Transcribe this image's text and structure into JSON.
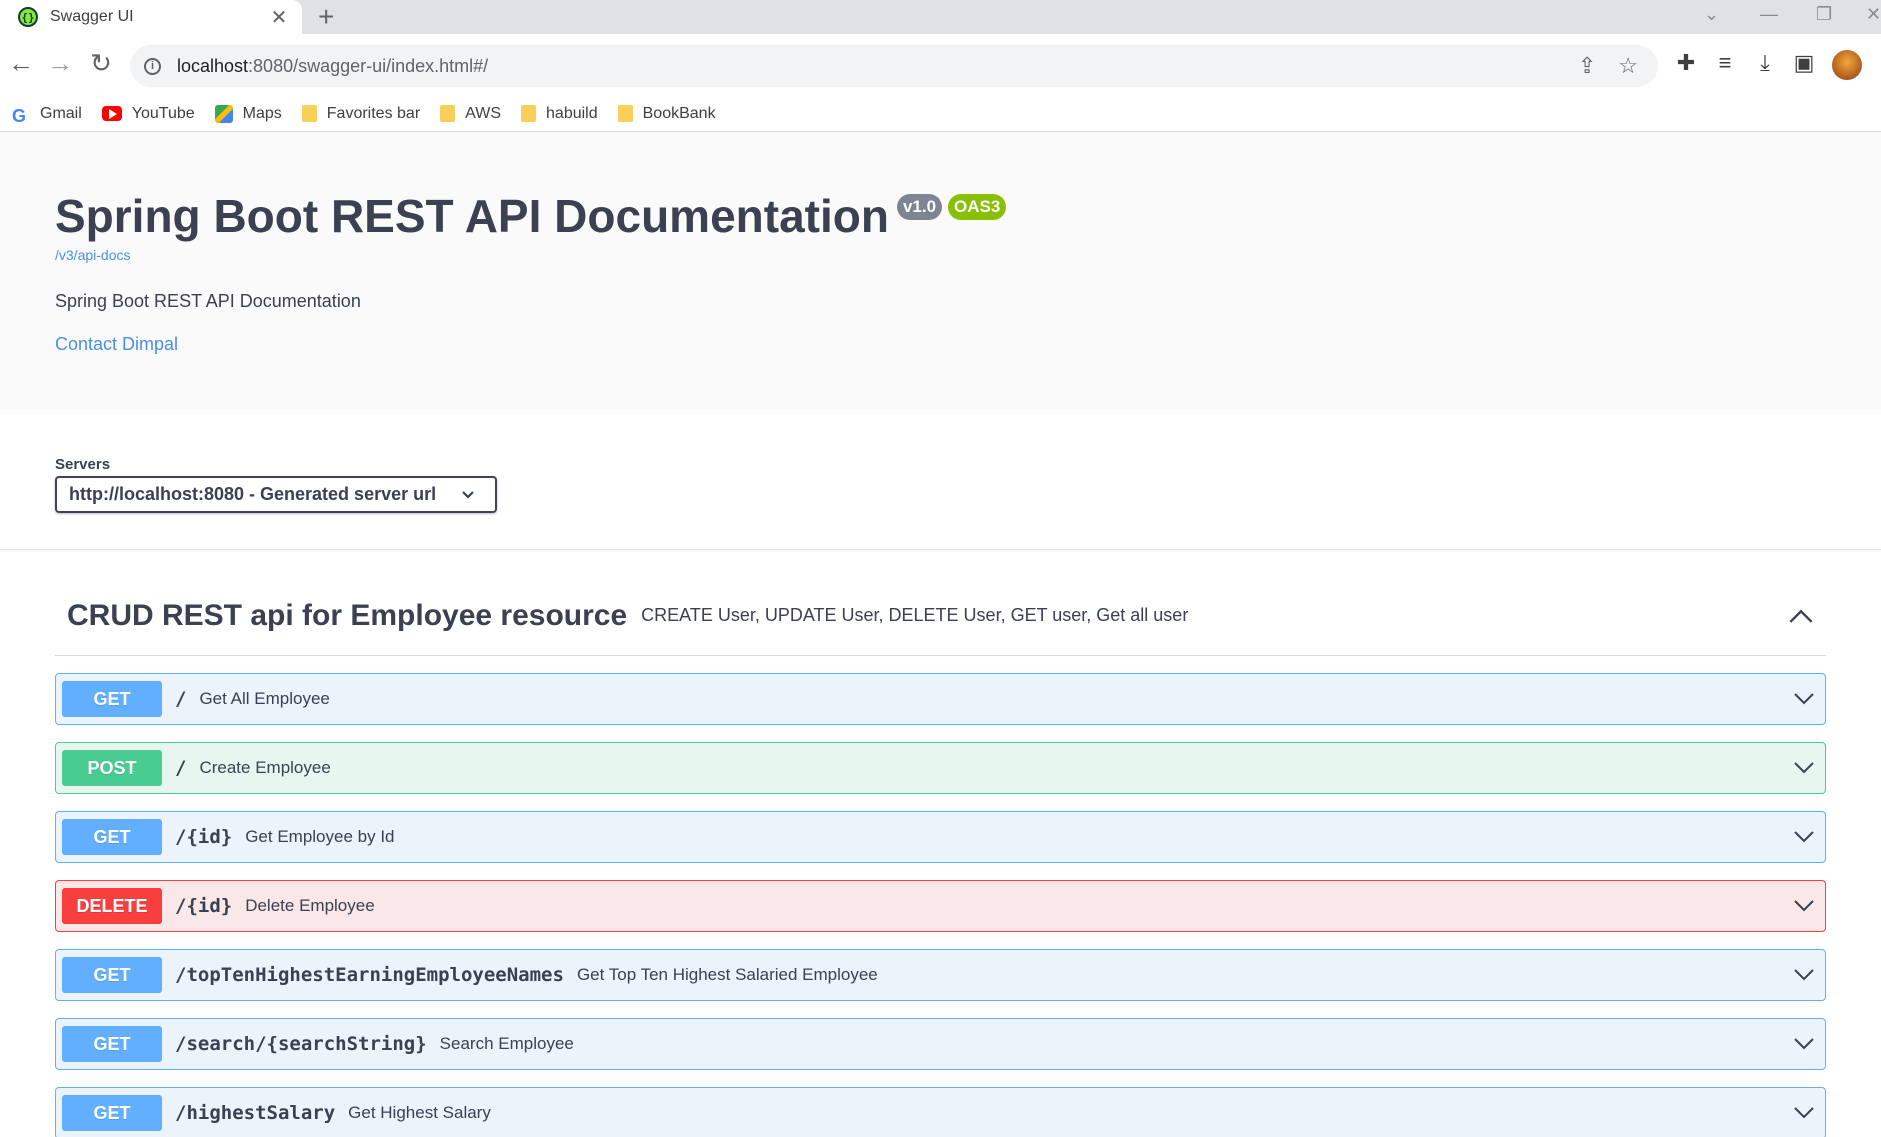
{
  "browser": {
    "tab_title": "Swagger UI",
    "tab_close": "✕",
    "new_tab": "+",
    "url_host": "localhost",
    "url_rest": ":8080/swagger-ui/index.html#/",
    "bookmarks": [
      "Gmail",
      "YouTube",
      "Maps",
      "Favorites bar",
      "AWS",
      "habuild",
      "BookBank"
    ]
  },
  "info": {
    "title": "Spring Boot REST API Documentation",
    "version": "v1.0",
    "oas": "OAS3",
    "api_docs_link": "/v3/api-docs",
    "description": "Spring Boot REST API Documentation",
    "contact": "Contact Dimpal"
  },
  "servers": {
    "label": "Servers",
    "selected": "http://localhost:8080 - Generated server url"
  },
  "tag": {
    "name": "CRUD REST api for Employee resource",
    "description": "CREATE User, UPDATE User, DELETE User, GET user, Get all user"
  },
  "operations": [
    {
      "method": "GET",
      "path": "/",
      "summary": "Get All Employee"
    },
    {
      "method": "POST",
      "path": "/",
      "summary": "Create Employee"
    },
    {
      "method": "GET",
      "path": "/{id}",
      "summary": "Get Employee by Id"
    },
    {
      "method": "DELETE",
      "path": "/{id}",
      "summary": "Delete Employee"
    },
    {
      "method": "GET",
      "path": "/topTenHighestEarningEmployeeNames",
      "summary": "Get Top Ten Highest Salaried Employee"
    },
    {
      "method": "GET",
      "path": "/search/{searchString}",
      "summary": "Search Employee"
    },
    {
      "method": "GET",
      "path": "/highestSalary",
      "summary": "Get Highest Salary"
    }
  ],
  "colors": {
    "get": "#61affe",
    "post": "#49cc90",
    "delete": "#f93e3e",
    "link": "#4990e2",
    "oas_badge": "#89bf04",
    "version_badge": "#7d8492"
  }
}
